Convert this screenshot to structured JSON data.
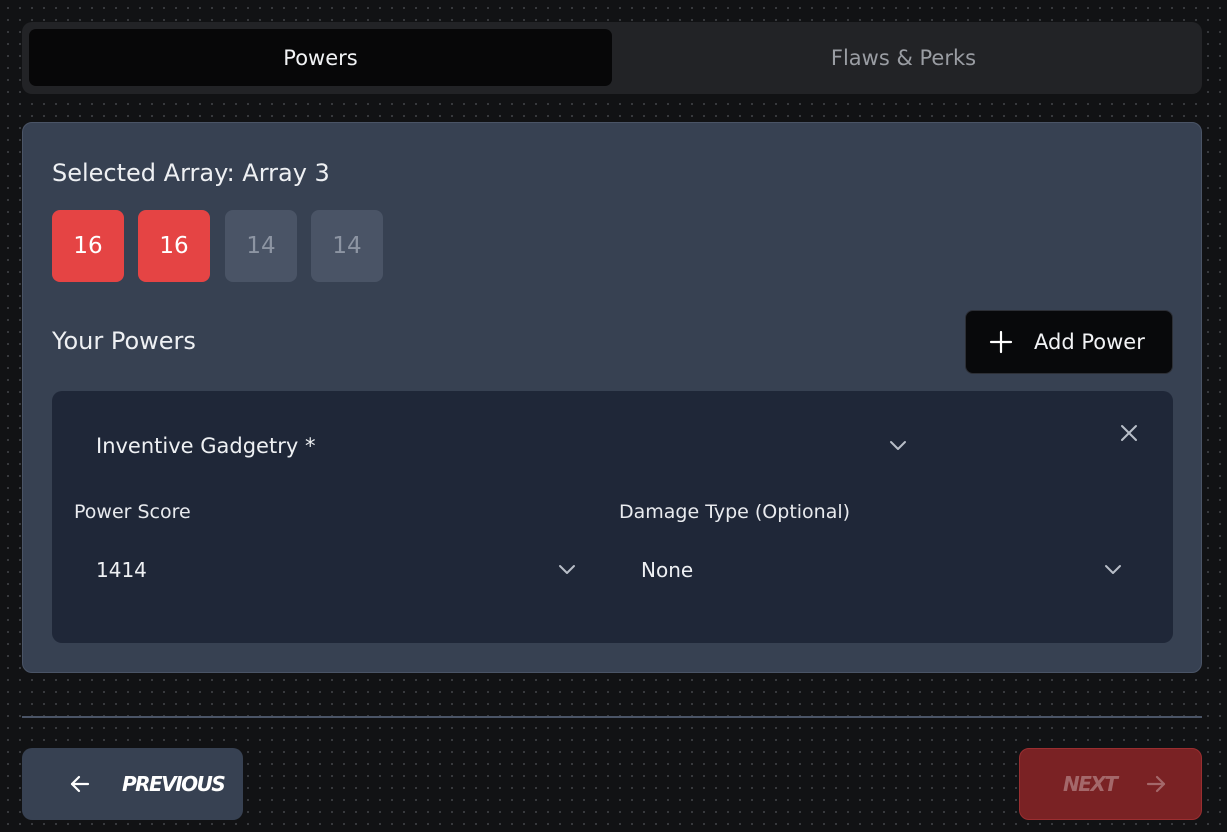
{
  "tabs": {
    "powers_label": "Powers",
    "flaws_label": "Flaws & Perks"
  },
  "array": {
    "title": "Selected Array: Array 3",
    "scores": [
      {
        "value": "16",
        "state": "used"
      },
      {
        "value": "16",
        "state": "used"
      },
      {
        "value": "14",
        "state": "free"
      },
      {
        "value": "14",
        "state": "free"
      }
    ]
  },
  "powers": {
    "heading": "Your Powers",
    "add_label": "Add Power",
    "items": [
      {
        "name": "Inventive Gadgetry *",
        "power_score_label": "Power Score",
        "power_score_value": "1414",
        "damage_type_label": "Damage Type (Optional)",
        "damage_type_value": "None"
      }
    ]
  },
  "nav": {
    "previous_label": "Previous",
    "next_label": "Next"
  },
  "icons": {
    "add": "plus-icon",
    "remove": "close-icon",
    "dropdown": "chevron-down-icon",
    "previous": "arrow-left-icon",
    "next": "arrow-right-icon"
  },
  "colors": {
    "accent_red": "#e54444",
    "panel": "#374152",
    "card": "#1f2738"
  }
}
